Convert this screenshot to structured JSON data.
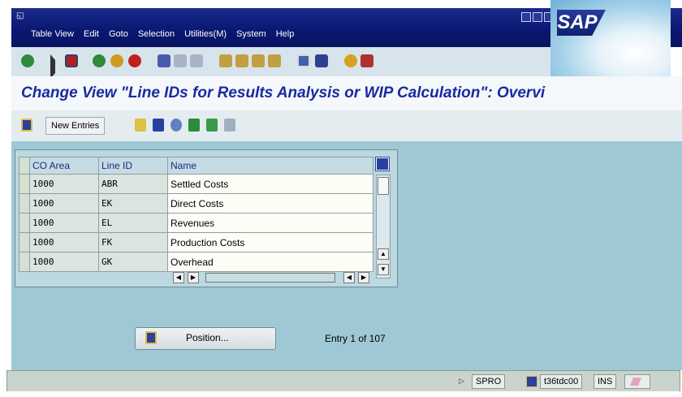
{
  "menubar": {
    "items": [
      "Table View",
      "Edit",
      "Goto",
      "Selection",
      "Utilities(M)",
      "System",
      "Help"
    ],
    "logo": "SAP"
  },
  "toolbar": {
    "icons": [
      "enter-icon",
      "command-field-icon",
      "save-icon",
      "back-icon",
      "exit-icon",
      "cancel-icon",
      "print-icon",
      "find-icon",
      "find-next-icon",
      "first-page-icon",
      "previous-page-icon",
      "next-page-icon",
      "last-page-icon",
      "create-session-icon",
      "shortcut-icon",
      "help-icon",
      "layout-icon"
    ]
  },
  "title": "Change View \"Line IDs for Results Analysis or WIP Calculation\": Overvi",
  "app_toolbar": {
    "new_entries": "New Entries"
  },
  "table": {
    "columns": [
      "CO Area",
      "Line ID",
      "Name"
    ],
    "rows": [
      {
        "co_area": "1000",
        "line_id": "ABR",
        "name": "Settled Costs"
      },
      {
        "co_area": "1000",
        "line_id": "EK",
        "name": "Direct Costs"
      },
      {
        "co_area": "1000",
        "line_id": "EL",
        "name": "Revenues"
      },
      {
        "co_area": "1000",
        "line_id": "FK",
        "name": "Production Costs"
      },
      {
        "co_area": "1000",
        "line_id": "GK",
        "name": "Overhead"
      }
    ]
  },
  "position_button": "Position...",
  "entry_info": "Entry 1 of 107",
  "status": {
    "transaction": "SPRO",
    "server": "t36tdc00",
    "mode": "INS"
  },
  "colors": {
    "menubar": "#0a1670",
    "title": "#1a2aa0",
    "background": "#9ec8d4"
  }
}
